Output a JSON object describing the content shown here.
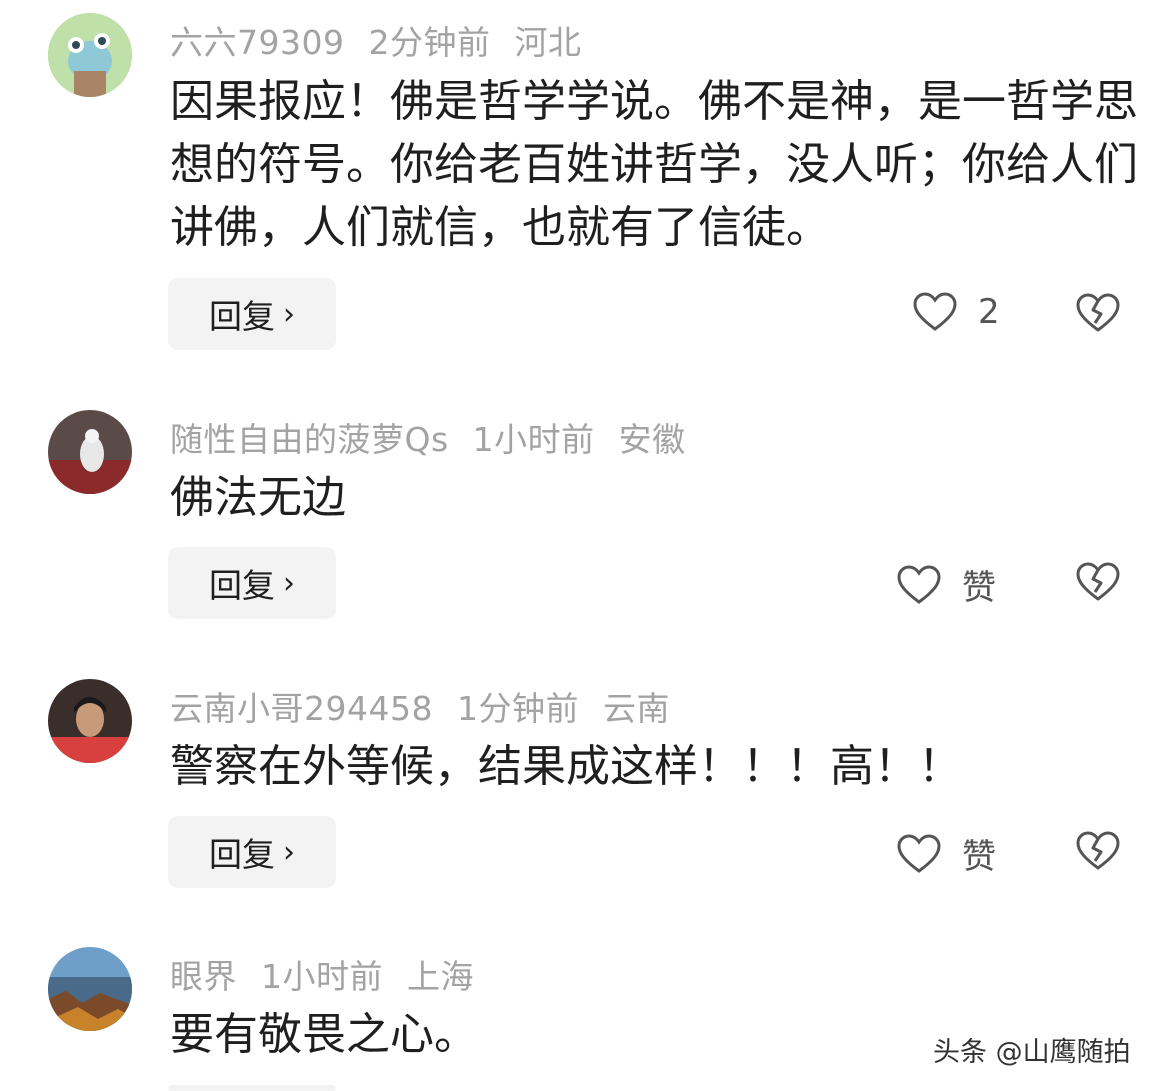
{
  "comments": [
    {
      "user": "六六79309",
      "time": "2分钟前",
      "location": "河北",
      "text": "因果报应！佛是哲学学说。佛不是神，是一哲学思想的符号。你给老百姓讲哲学，没人听；你给人们讲佛，人们就信，也就有了信徒。",
      "reply_label": "回复",
      "likes": "2"
    },
    {
      "user": "随性自由的菠萝Qs",
      "time": "1小时前",
      "location": "安徽",
      "text": "佛法无边",
      "reply_label": "回复",
      "likes": "赞"
    },
    {
      "user": "云南小哥294458",
      "time": "1分钟前",
      "location": "云南",
      "text": "警察在外等候，结果成这样！！！高！！",
      "reply_label": "回复",
      "likes": "赞"
    },
    {
      "user": "眼界",
      "time": "1小时前",
      "location": "上海",
      "text": "要有敬畏之心。"
    }
  ],
  "watermark": "头条 @山鹰随拍",
  "icons": {
    "like": "heart-outline-icon",
    "dislike": "broken-heart-icon",
    "reply_arrow": "chevron-right-icon"
  }
}
